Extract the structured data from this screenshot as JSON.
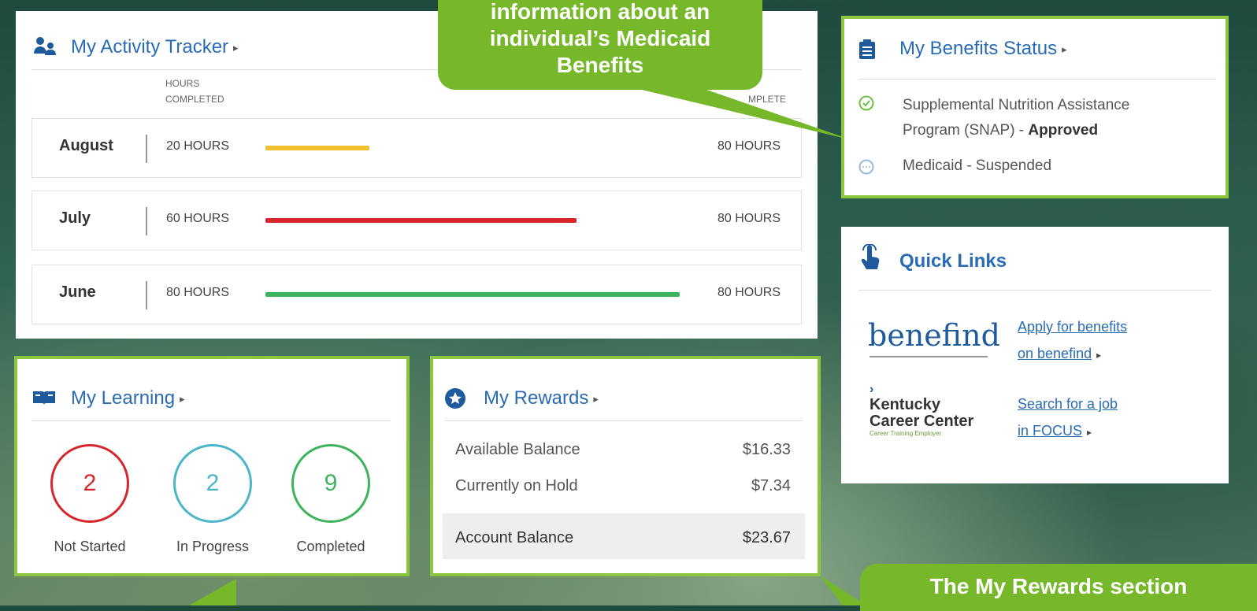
{
  "activity": {
    "title": "My Activity Tracker",
    "arrow": "▸",
    "col_hours_line1": "HOURS",
    "col_hours_line2": "COMPLETED",
    "col_right": "MPLETE",
    "rows": [
      {
        "month": "August",
        "hours": "20 HOURS",
        "goal": "80 HOURS",
        "progress": 0.25,
        "color": "#f2c12e"
      },
      {
        "month": "July",
        "hours": "60 HOURS",
        "goal": "80 HOURS",
        "progress": 0.75,
        "color": "#d7262b"
      },
      {
        "month": "June",
        "hours": "80 HOURS",
        "goal": "80 HOURS",
        "progress": 1.0,
        "color": "#3db35c"
      }
    ]
  },
  "callout_top": {
    "line1": "information about an",
    "line2": "individual’s Medicaid",
    "line3": "Benefits"
  },
  "benefits": {
    "title": "My Benefits Status",
    "arrow": "▸",
    "items": [
      {
        "name_line1": "Supplemental Nutrition Assistance",
        "name_line2": "Program (SNAP)",
        "dash": " - ",
        "status": "Approved"
      },
      {
        "name": "Medicaid - Suspended"
      }
    ]
  },
  "quick_links": {
    "title": "Quick Links",
    "benefind_logo": "benefind",
    "benefind_link_line1": "Apply for benefits",
    "benefind_link_line2": "on benefind",
    "kcc_logo_line1": "Kentucky",
    "kcc_logo_line2": "Career Center",
    "kcc_logo_tagline": "Career  Training  Employer",
    "kcc_link_line1": "Search for a job",
    "kcc_link_line2": "in FOCUS",
    "arrow": "▸"
  },
  "learning": {
    "title": "My Learning",
    "arrow": "▸",
    "stats": [
      {
        "value": "2",
        "label": "Not Started",
        "color": "#d7262b"
      },
      {
        "value": "2",
        "label": "In Progress",
        "color": "#4bb5c9"
      },
      {
        "value": "9",
        "label": "Completed",
        "color": "#3db35c"
      }
    ]
  },
  "rewards": {
    "title": "My Rewards",
    "arrow": "▸",
    "available_label": "Available Balance",
    "available_value": "$16.33",
    "hold_label": "Currently on Hold",
    "hold_value": "$7.34",
    "account_label": "Account Balance",
    "account_value": "$23.67"
  },
  "callout_bottom": {
    "text": "The My Rewards section"
  },
  "colors": {
    "highlight": "#8cc63f",
    "callout": "#76b82a",
    "link": "#2a6bb5"
  }
}
